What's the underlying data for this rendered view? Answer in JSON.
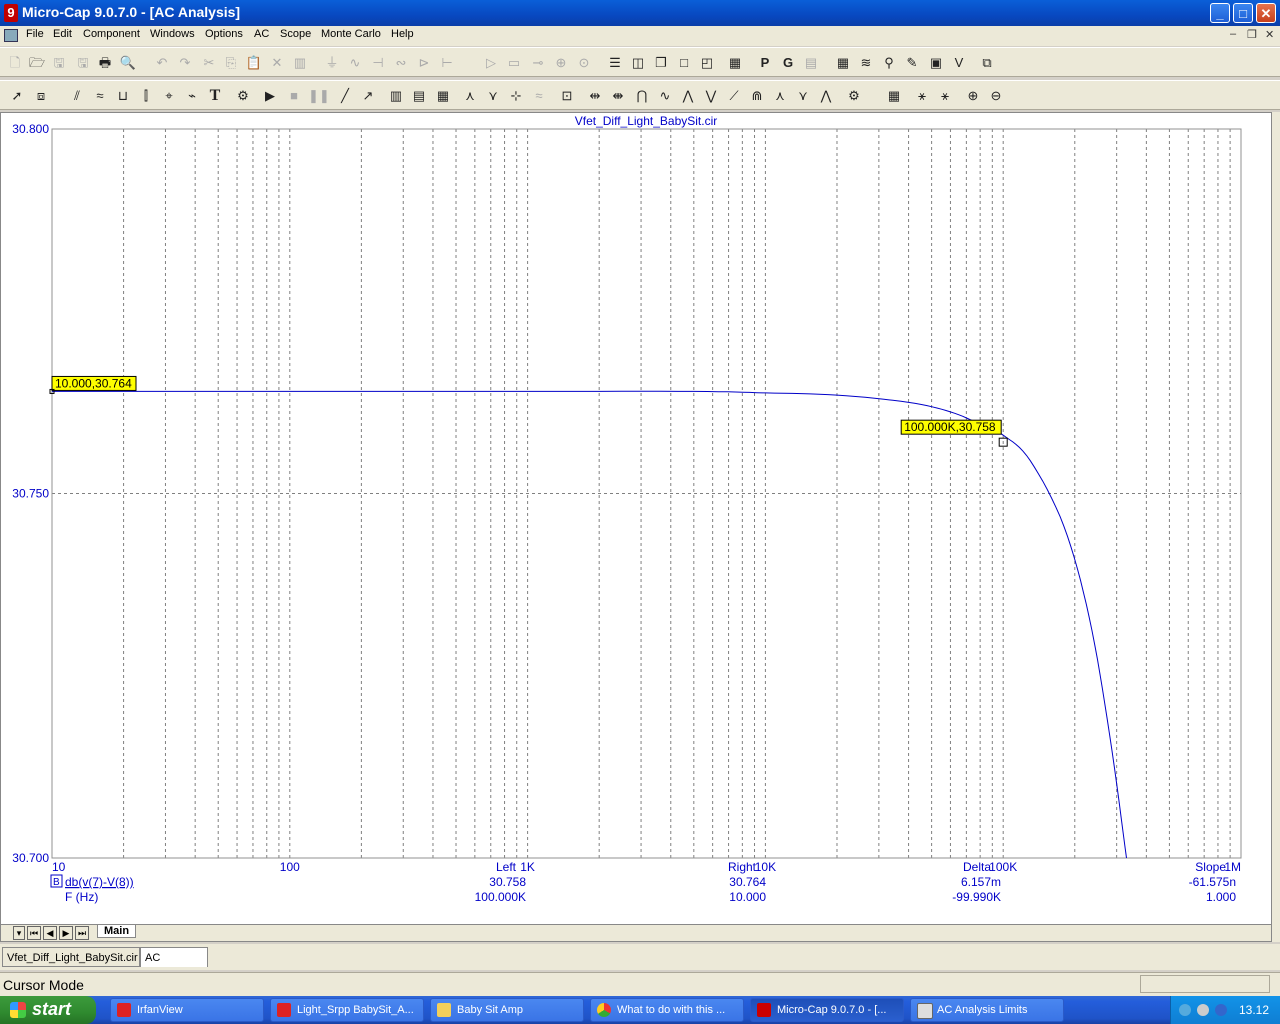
{
  "window": {
    "title": "Micro-Cap 9.0.7.0 - [AC Analysis]",
    "minimize": "_",
    "maximize": "□",
    "close": "✕"
  },
  "menu": {
    "items": [
      "File",
      "Edit",
      "Component",
      "Windows",
      "Options",
      "AC",
      "Scope",
      "Monte Carlo",
      "Help"
    ]
  },
  "plot": {
    "title": "Vfet_Diff_Light_BabySit.cir",
    "y_ticks": [
      "30.800",
      "30.750",
      "30.700"
    ],
    "x_ticks": [
      "10",
      "100",
      "1K",
      "10K",
      "100K",
      "1M"
    ],
    "cursor_left_label": "10.000,30.764",
    "cursor_right_label": "100.000K,30.758",
    "trace_label": "db(v(7)-V(8))",
    "trace_marker": "B",
    "x_expression": "F (Hz)",
    "trace_color": "#0000c8",
    "axis_color": "#0000c8"
  },
  "chart_data": {
    "type": "line",
    "title": "Vfet_Diff_Light_BabySit.cir",
    "xlabel": "F (Hz)",
    "ylabel": "db(v(7)-V(8))",
    "x_scale": "log",
    "xlim": [
      10,
      1000000
    ],
    "ylim": [
      30.7,
      30.8
    ],
    "grid": true,
    "series": [
      {
        "name": "db(v(7)-V(8))",
        "x": [
          10,
          100,
          1000,
          5000,
          10000,
          20000,
          40000,
          60000,
          80000,
          100000,
          130000,
          180000,
          230000,
          280000,
          330000
        ],
        "y": [
          30.764,
          30.764,
          30.764,
          30.764,
          30.7638,
          30.7635,
          30.7625,
          30.7612,
          30.7595,
          30.758,
          30.7545,
          30.7455,
          30.733,
          30.717,
          30.7
        ]
      }
    ]
  },
  "readout": {
    "headers": [
      "Left",
      "Right",
      "Delta",
      "Slope"
    ],
    "row1": [
      "30.758",
      "30.764",
      "6.157m",
      "-61.575n"
    ],
    "row2": [
      "100.000K",
      "10.000",
      "-99.990K",
      "1.000"
    ]
  },
  "sheet_tabs": {
    "main": "Main"
  },
  "bottom_tabs": [
    "Vfet_Diff_Light_BabySit.cir",
    "AC Analysis"
  ],
  "status": {
    "text": "Cursor Mode"
  },
  "taskbar": {
    "start": "start",
    "tasks": [
      "IrfanView",
      "Light_Srpp BabySit_A...",
      "Baby Sit Amp",
      "What to do with this ...",
      "Micro-Cap 9.0.7.0 - [...",
      "AC Analysis Limits"
    ],
    "clock": "13.12"
  }
}
